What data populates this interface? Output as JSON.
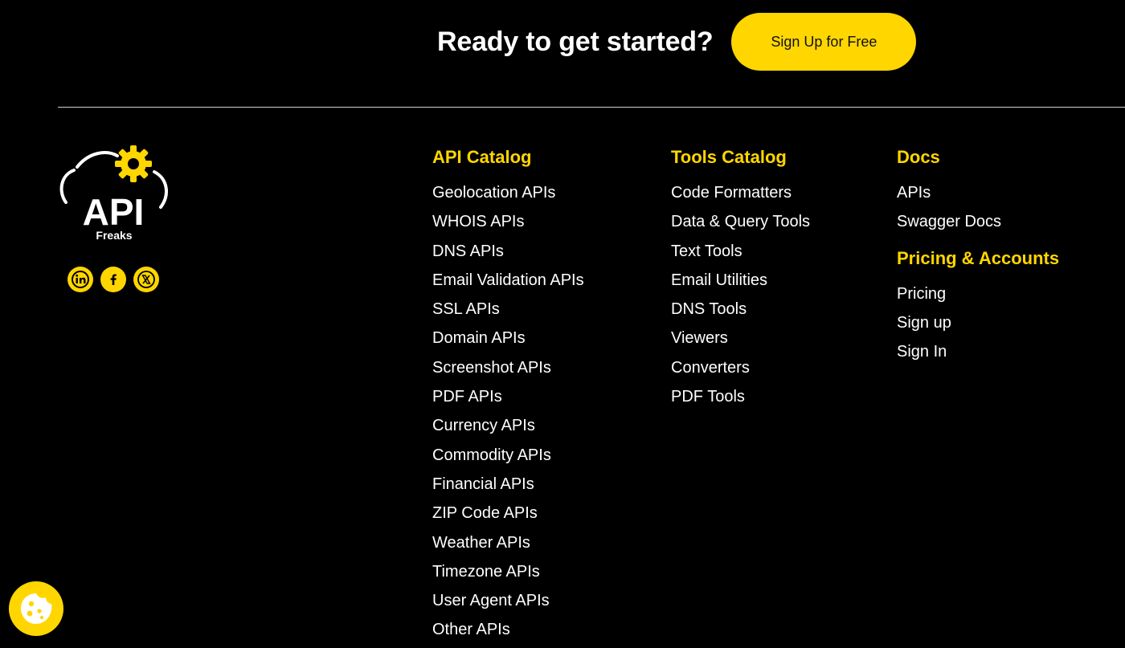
{
  "cta": {
    "heading": "Ready to get started?",
    "button_label": "Sign Up for Free"
  },
  "brand": {
    "logo_text": "API",
    "logo_subtext": "Freaks",
    "icon": "gear-icon",
    "accent_color": "#ffd600"
  },
  "social": [
    {
      "name": "linkedin",
      "icon": "linkedin-icon"
    },
    {
      "name": "facebook",
      "icon": "facebook-icon"
    },
    {
      "name": "x",
      "icon": "x-icon"
    }
  ],
  "api_catalog": {
    "heading": "API Catalog",
    "items": [
      "Geolocation APIs",
      "WHOIS APIs",
      "DNS APIs",
      "Email Validation APIs",
      "SSL APIs",
      "Domain APIs",
      "Screenshot APIs",
      "PDF APIs",
      "Currency APIs",
      "Commodity APIs",
      "Financial APIs",
      "ZIP Code APIs",
      "Weather APIs",
      "Timezone APIs",
      "User Agent APIs",
      "Other APIs"
    ]
  },
  "tools_catalog": {
    "heading": "Tools Catalog",
    "items": [
      "Code Formatters",
      "Data & Query Tools",
      "Text Tools",
      "Email Utilities",
      "DNS Tools",
      "Viewers",
      "Converters",
      "PDF Tools"
    ]
  },
  "docs": {
    "heading": "Docs",
    "items": [
      "APIs",
      "Swagger Docs"
    ]
  },
  "pricing_accounts": {
    "heading": "Pricing & Accounts",
    "items": [
      "Pricing",
      "Sign up",
      "Sign In"
    ]
  },
  "cookie_widget": {
    "icon": "cookie-icon"
  }
}
